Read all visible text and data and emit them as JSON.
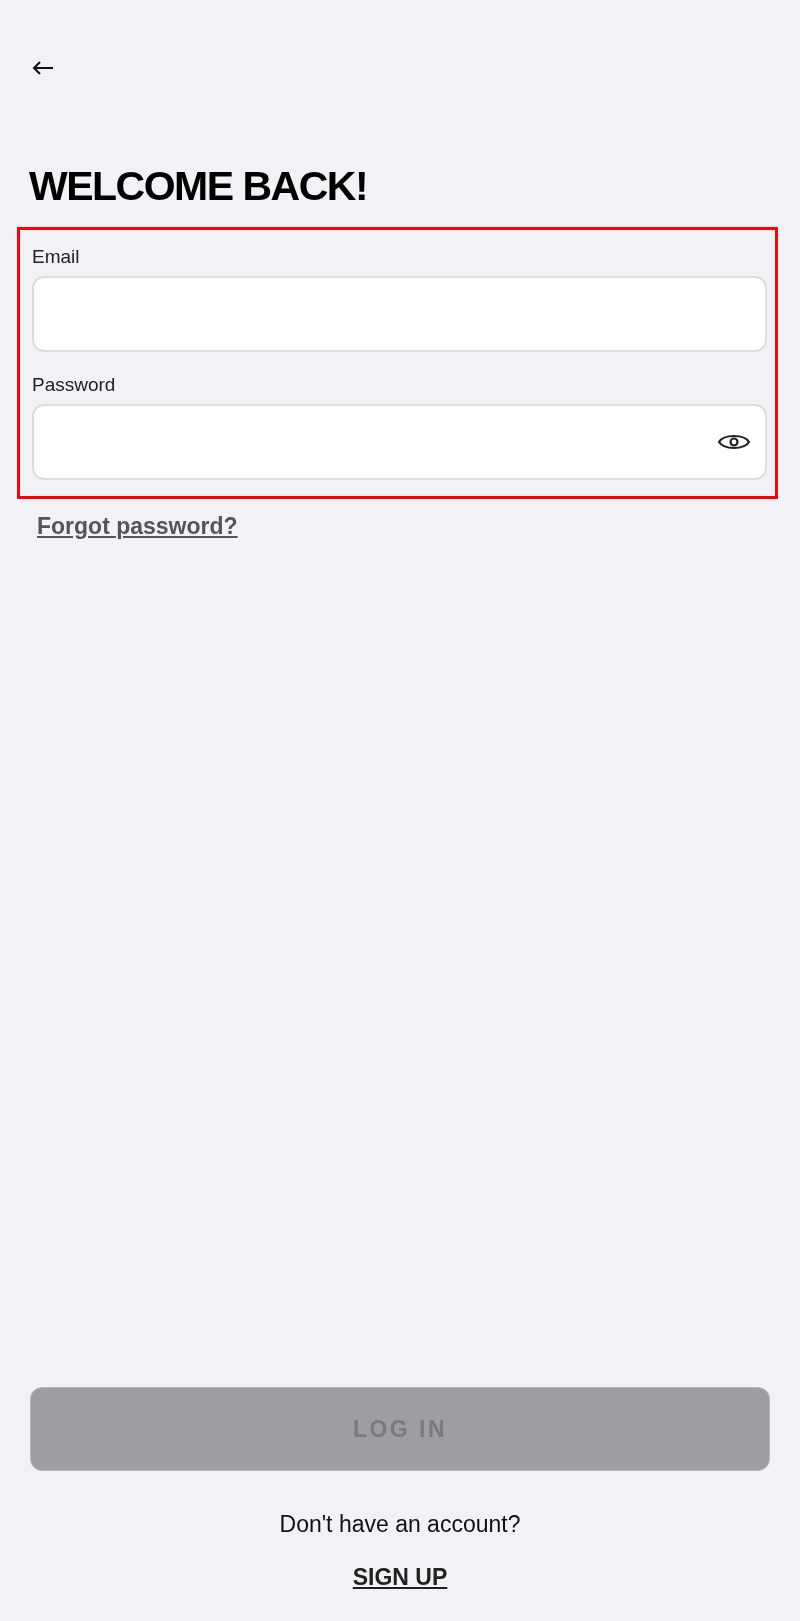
{
  "title": "WELCOME BACK!",
  "form": {
    "highlighted": true,
    "fields": [
      {
        "label": "Email",
        "kind": "text"
      },
      {
        "label": "Password",
        "kind": "password"
      }
    ]
  },
  "forgot_link": "Forgot password?",
  "login_button": {
    "label": "LOG IN",
    "disabled": true
  },
  "signup_prompt": "Don't have an account?",
  "signup_link": "SIGN UP"
}
